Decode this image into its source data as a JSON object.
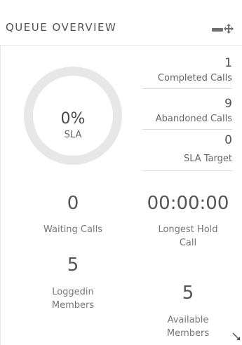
{
  "widget": {
    "title": "QUEUE OVERVIEW",
    "controls": {
      "minimize_icon": "minimize-icon",
      "move_icon": "move-icon",
      "resize_icon": "resize-icon"
    }
  },
  "sla": {
    "value": "0%",
    "label": "SLA"
  },
  "stats": [
    {
      "value": "1",
      "label": "Completed Calls"
    },
    {
      "value": "9",
      "label": "Abandoned Calls"
    },
    {
      "value": "0",
      "label": "SLA Target"
    }
  ],
  "metrics": {
    "waiting": {
      "value": "0",
      "label": "Waiting Calls"
    },
    "longest_hold": {
      "value": "00:00:00",
      "label_line1": "Longest Hold",
      "label_line2": "Call"
    },
    "loggedin": {
      "value": "5",
      "label_line1": "Loggedin",
      "label_line2": "Members"
    },
    "available": {
      "value": "5",
      "label_line1": "Available",
      "label_line2": "Members"
    }
  },
  "colors": {
    "donut_ring": "#e7e7e7",
    "text": "#555555",
    "divider": "#dcdcdc"
  }
}
